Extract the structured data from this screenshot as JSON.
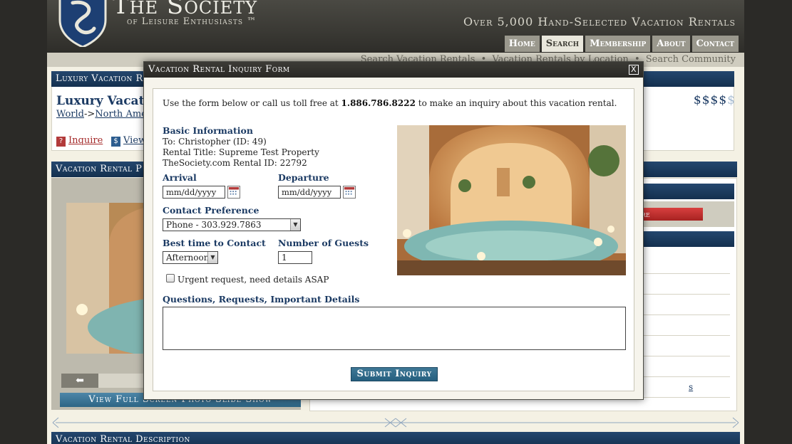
{
  "site": {
    "title": "The Society",
    "subtitle": "of Leisure Enthusiasts ™",
    "tagline": "Over 5,000 Hand-Selected Vacation Rentals"
  },
  "nav": {
    "items": [
      "Home",
      "Search",
      "Membership",
      "About",
      "Contact"
    ],
    "active": "Search"
  },
  "subnav": {
    "items": [
      "Search Vacation Rentals",
      "Vacation Rentals by Location",
      "Search Community"
    ]
  },
  "listing": {
    "section_header": "Luxury Vacation R",
    "title": "Luxury Vacatio",
    "breadcrumb": [
      "World",
      "North Amer"
    ],
    "breadcrumb_sep": "->",
    "price": "$$$$",
    "price_dim": "$",
    "inquire_label": "Inquire",
    "view_label": "View"
  },
  "photos": {
    "section_header": "Vacation Rental P",
    "slideshow_label": "View Full Screen Photo Slide Show"
  },
  "right_panel": {
    "button_fragment": "uire",
    "link_fragment": "s"
  },
  "description": {
    "section_header": "Vacation Rental Description"
  },
  "modal": {
    "title": "Vacation Rental Inquiry Form",
    "close_label": "X",
    "intro_before": "Use the form below or call us toll free at ",
    "intro_phone": "1.886.786.8222",
    "intro_after": " to make an inquiry about this vacation rental.",
    "basic_info": {
      "heading": "Basic Information",
      "to": "To: Christopher (ID: 49)",
      "rental_title": "Rental Title: Supreme Test Property",
      "rental_id": "TheSociety.com Rental ID: 22792"
    },
    "arrival": {
      "label": "Arrival",
      "placeholder": "mm/dd/yyyy"
    },
    "departure": {
      "label": "Departure",
      "placeholder": "mm/dd/yyyy"
    },
    "contact_preference": {
      "label": "Contact Preference",
      "value": "Phone - 303.929.7863"
    },
    "best_time": {
      "label": "Best time to Contact",
      "value": "Afternoon"
    },
    "guests": {
      "label": "Number of Guests",
      "value": "1"
    },
    "urgent": {
      "label": "Urgent request, need details ASAP",
      "checked": false
    },
    "details": {
      "label": "Questions, Requests, Important Details",
      "value": ""
    },
    "submit_label": "Submit Inquiry"
  },
  "colors": {
    "navy": "#1b3a63",
    "header_dark": "#3a3934",
    "inquire_red": "#a42a2a",
    "submit_blue": "#2d6585"
  }
}
